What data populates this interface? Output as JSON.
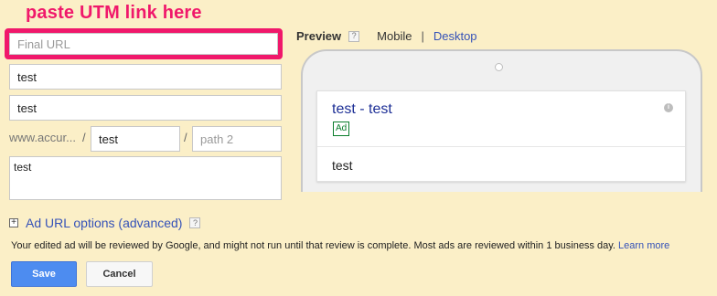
{
  "annotation": {
    "text": "paste UTM link here",
    "color": "#f0186b"
  },
  "form": {
    "final_url": {
      "value": "",
      "placeholder": "Final URL"
    },
    "headline1": {
      "value": "test"
    },
    "headline2": {
      "value": "test"
    },
    "display_url_base": "www.accur...",
    "path1": {
      "value": "test"
    },
    "path2": {
      "value": "",
      "placeholder": "path 2"
    },
    "description": {
      "value": "test"
    }
  },
  "preview": {
    "title": "Preview",
    "help_icon": "?",
    "mobile_label": "Mobile",
    "separator": "|",
    "desktop_label": "Desktop",
    "ad": {
      "headline": "test - test",
      "badge": "Ad",
      "info_icon": "i",
      "description": "test"
    }
  },
  "ad_url_options": {
    "icon": "+",
    "label": "Ad URL options (advanced)",
    "help_icon": "?"
  },
  "review_notice": {
    "text": "Your edited ad will be reviewed by Google, and might not run until that review is complete. Most ads are reviewed within 1 business day.",
    "link_text": "Learn more"
  },
  "buttons": {
    "save": "Save",
    "cancel": "Cancel"
  },
  "colors": {
    "background": "#fbefc7",
    "link": "#3552b8",
    "save_button": "#4d8cf0",
    "ad_badge": "#0a7d2c"
  }
}
